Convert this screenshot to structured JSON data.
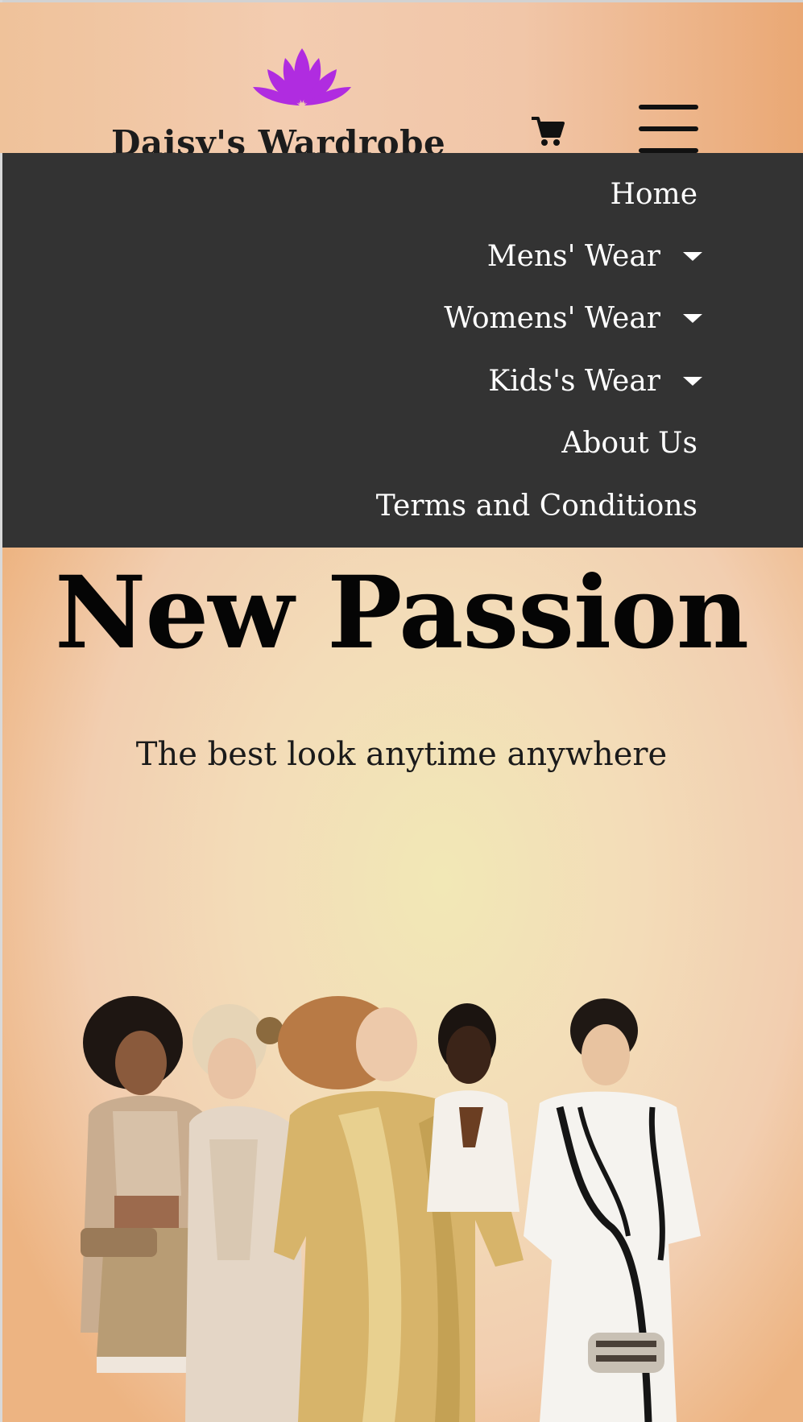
{
  "header": {
    "brand_name": "Daisy's Wardrobe",
    "lotus_color": "#b02ce0",
    "cart_icon": "cart-icon",
    "menu_icon": "hamburger-menu-icon"
  },
  "nav": {
    "background": "#333333",
    "items": [
      {
        "label": "Home",
        "has_submenu": false
      },
      {
        "label": "Mens' Wear",
        "has_submenu": true
      },
      {
        "label": "Womens' Wear",
        "has_submenu": true
      },
      {
        "label": "Kids's Wear",
        "has_submenu": true
      },
      {
        "label": "About Us",
        "has_submenu": false
      },
      {
        "label": "Terms and Conditions",
        "has_submenu": false
      }
    ]
  },
  "hero": {
    "title": "New Passion",
    "subtitle": "The best look anytime anywhere"
  }
}
